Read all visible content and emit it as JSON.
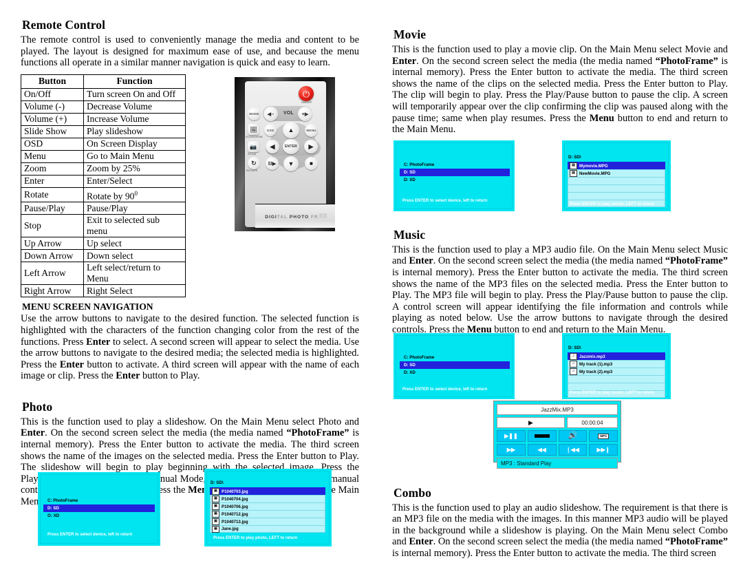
{
  "left": {
    "remote_control": {
      "title": "Remote Control",
      "intro": "The remote control is used to conveniently manage the media and content to be played. The layout is designed for maximum ease of use, and because the menu functions all operate in a similar manner navigation is quick and easy to learn.",
      "table": {
        "headers": [
          "Button",
          "Function"
        ],
        "rows": [
          [
            "On/Off",
            "Turn screen On and Off"
          ],
          [
            "Volume (-)",
            "Decrease Volume"
          ],
          [
            "Volume (+)",
            "Increase Volume"
          ],
          [
            "Slide Show",
            "Play slideshow"
          ],
          [
            "OSD",
            "On Screen Display"
          ],
          [
            "Menu",
            "Go to Main Menu"
          ],
          [
            "Zoom",
            "Zoom by 25%"
          ],
          [
            "Enter",
            "Enter/Select"
          ],
          [
            "Rotate",
            "Rotate by 90"
          ],
          [
            "Pause/Play",
            "Pause/Play"
          ],
          [
            "Stop",
            "Exit to selected sub menu"
          ],
          [
            "Up Arrow",
            "Up select"
          ],
          [
            "Down Arrow",
            "Down select"
          ],
          [
            "Left Arrow",
            "Left select/return to Menu"
          ],
          [
            "Right Arrow",
            "Right Select"
          ]
        ],
        "rotate_superscript": "0"
      }
    },
    "remote_image": {
      "power_label": "ON/OFF",
      "mode_label": "MODE",
      "vol_label": "VOL",
      "vol_minus": "◀–",
      "vol_plus": "+▶",
      "slideshow_label": "SLIDESHOW",
      "osd_label": "OSD",
      "menu_label": "MENU",
      "zoom_label": "ZOOM",
      "enter_label": "ENTER",
      "rotate_label": "ROTATE",
      "up_glyph": "▲",
      "down_glyph": "▼",
      "left_glyph": "◀",
      "right_glyph": "▶",
      "playpause_glyph": "‖/▶",
      "stop_glyph": "■",
      "power_glyph": "⏻",
      "footer_text_visible": "DIGI",
      "footer_text_faded": "TAL",
      "footer_text_visible2": "PHOTO",
      "footer_text_faded2": "FR"
    },
    "menu_nav": {
      "heading": "MENU SCREEN NAVIGATION",
      "text_1": "Use the arrow buttons to navigate to the desired function. The selected function is highlighted with the characters of the function changing color from the rest of the functions. Press ",
      "bold_1": "Enter",
      "text_2": " to select. A second screen will appear to select the media. Use the arrow buttons to navigate to the desired media; the selected media is highlighted. Press the ",
      "bold_2": "Enter",
      "text_3": " button to activate. A third screen will appear with the name of each image or clip. Press the ",
      "bold_3": "Enter",
      "text_4": " button to Play."
    },
    "photo": {
      "title": "Photo",
      "text_1": "This is the function used to play a slideshow. On the Main Menu select Photo and ",
      "bold_1": "Enter",
      "text_2": ". On the second screen select the media (the media named ",
      "bold_2": "“PhotoFrame”",
      "text_3": " is internal memory). Press the Enter button to activate the media.  The third screen shows the name of the images on the selected media. Press the Enter button to Play. The slideshow will begin to play beginning with the selected image. Press the Play/Pause button to change to Manual Mode, were each image is played by manual control using the arrow buttons. Press the ",
      "bold_3": "Menu",
      "text_4": " button to end and return to the Main Menu."
    },
    "photo_screen_device": {
      "devices": [
        {
          "label": "C:  PhotoFrame",
          "selected": false
        },
        {
          "label": "D:  SD",
          "selected": true
        },
        {
          "label": "O:  XD",
          "selected": false
        }
      ],
      "hint": "Press ENTER to select device, left to return"
    },
    "photo_screen_files": {
      "path": "D: SD\\",
      "files": [
        {
          "name": "P1040703.jpg",
          "selected": true
        },
        {
          "name": "P1040704.jpg",
          "selected": false
        },
        {
          "name": "P1040706.jpg",
          "selected": false
        },
        {
          "name": "P1040712.jpg",
          "selected": false
        },
        {
          "name": "P1040713.jpg",
          "selected": false
        },
        {
          "name": "Jane.jpg",
          "selected": false
        }
      ],
      "hint": "Press ENTER to play photo, LEFT to return"
    }
  },
  "right": {
    "movie": {
      "title": "Movie",
      "text_1": "This is the function used to play a movie clip. On the Main Menu select Movie and ",
      "bold_1": "Enter",
      "text_2": ". On the second screen select the media (the media named ",
      "bold_2": "“PhotoFrame”",
      "text_3": " is internal memory). Press the Enter button to activate the media.  The third screen shows the name of the clips on the selected media. Press the Enter button to Play. The clip will begin to play. Press the Play/Pause button to pause the clip. A screen will temporarily appear over the clip confirming the clip was paused along with the pause time; same when play resumes. Press the ",
      "bold_3": "Menu",
      "text_4": " button to end and return to the Main Menu."
    },
    "movie_screen_device": {
      "devices": [
        {
          "label": "C:  PhotoFrame",
          "selected": false
        },
        {
          "label": "D:  SD",
          "selected": true
        },
        {
          "label": "D:  XD",
          "selected": false
        }
      ],
      "hint": "Press ENTER to select device, left to return"
    },
    "movie_screen_files": {
      "path": "D: SD\\",
      "files": [
        {
          "name": "Mymovie.MPG",
          "selected": true
        },
        {
          "name": "NewMovie.MPG",
          "selected": false
        },
        {
          "name": "",
          "selected": false
        },
        {
          "name": "",
          "selected": false
        },
        {
          "name": "",
          "selected": false
        },
        {
          "name": "",
          "selected": false
        }
      ],
      "hint": "Press ENTER to play movie, LEFT to return"
    },
    "music": {
      "title": "Music",
      "text_1": "This is the function used to play a MP3 audio file. On the Main Menu select Music and ",
      "bold_1": "Enter",
      "text_2": ". On the second screen select the media (the media named ",
      "bold_2": "“PhotoFrame”",
      "text_3": " is internal memory). Press the Enter button to activate the media.  The third screen shows the name of the MP3 files on the selected media. Press the Enter button to Play. The MP3 file will begin to play. Press the Play/Pause button to pause the clip. A control screen will appear identifying the file information and controls while playing as noted below. Use the arrow buttons to navigate through the desired controls. Press the ",
      "bold_3": "Menu",
      "text_4": " button to end and return to the Main Menu."
    },
    "music_screen_device": {
      "devices": [
        {
          "label": "C:  PhotoFrame",
          "selected": false
        },
        {
          "label": "D:  SD",
          "selected": true
        },
        {
          "label": "D:  XD",
          "selected": false
        }
      ],
      "hint": "Press ENTER to select device, left to return"
    },
    "music_screen_files": {
      "path": "D: SD\\",
      "files": [
        {
          "name": "Jazzmix.mp3",
          "selected": true
        },
        {
          "name": "My track (1).mp3",
          "selected": false
        },
        {
          "name": "My track (2).mp3",
          "selected": false
        },
        {
          "name": "",
          "selected": false
        },
        {
          "name": "",
          "selected": false
        },
        {
          "name": "",
          "selected": false
        }
      ],
      "hint": "Press ENTER to play music, LEFT to return"
    },
    "mp3_panel": {
      "track_title": "JazzMix.MP3",
      "play_glyph": "▶",
      "time": "00:00:04",
      "buttons_row1": [
        "▶‖",
        "bar",
        "speaker",
        "mp3chip"
      ],
      "buttons_row2": [
        "▶▶",
        "◀◀",
        "❘◀◀",
        "▶▶❙"
      ],
      "speaker_glyph": "ὐA",
      "chip_label": "MP3",
      "mode_text": "MP3 : Standard Play"
    },
    "combo": {
      "title": "Combo",
      "text_1": "This is the function used to play an audio slideshow. The requirement is that there is an MP3 file on the media with the images. In this manner MP3 audio will be played in the background while a slideshow is playing. On the Main Menu select Combo and ",
      "bold_1": "Enter",
      "text_2": ". On the second screen select the media (the media named ",
      "bold_2": "“PhotoFrame”",
      "text_3": " is internal memory). Press the Enter button to activate the media.  The third screen"
    }
  }
}
